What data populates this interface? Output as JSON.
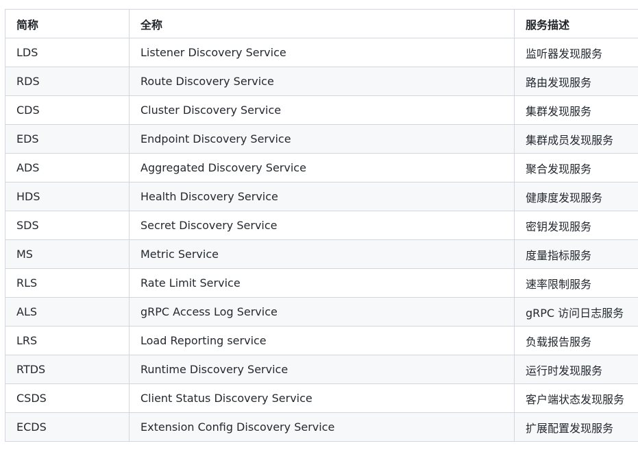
{
  "table": {
    "headers": [
      "简称",
      "全称",
      "服务描述"
    ],
    "rows": [
      [
        "LDS",
        "Listener Discovery Service",
        "监听器发现服务"
      ],
      [
        "RDS",
        "Route Discovery Service",
        "路由发现服务"
      ],
      [
        "CDS",
        "Cluster Discovery Service",
        "集群发现服务"
      ],
      [
        "EDS",
        "Endpoint Discovery Service",
        "集群成员发现服务"
      ],
      [
        "ADS",
        "Aggregated Discovery Service",
        "聚合发现服务"
      ],
      [
        "HDS",
        "Health Discovery Service",
        "健康度发现服务"
      ],
      [
        "SDS",
        "Secret Discovery Service",
        "密钥发现服务"
      ],
      [
        "MS",
        "Metric Service",
        "度量指标服务"
      ],
      [
        "RLS",
        "Rate Limit Service",
        "速率限制服务"
      ],
      [
        "ALS",
        "gRPC Access Log Service",
        "gRPC 访问日志服务"
      ],
      [
        "LRS",
        "Load Reporting service",
        "负载报告服务"
      ],
      [
        "RTDS",
        "Runtime Discovery Service",
        "运行时发现服务"
      ],
      [
        "CSDS",
        "Client Status Discovery Service",
        "客户端状态发现服务"
      ],
      [
        "ECDS",
        "Extension Config Discovery Service",
        "扩展配置发现服务"
      ]
    ]
  }
}
